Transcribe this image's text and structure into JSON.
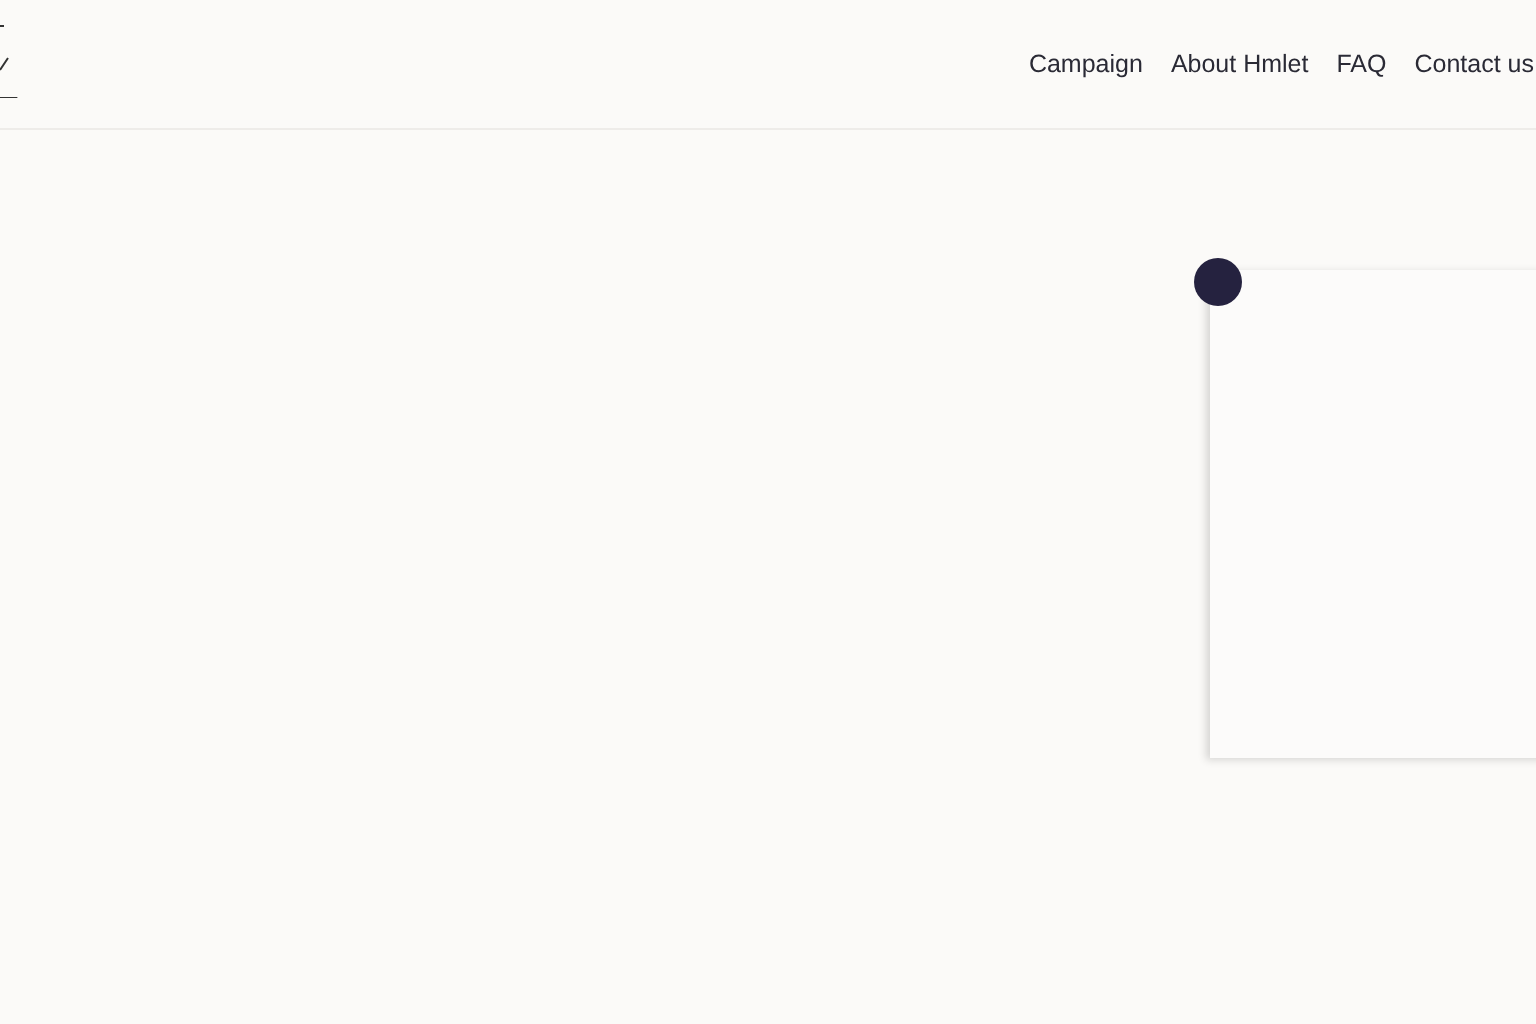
{
  "nav": {
    "links": [
      {
        "label": "Campaign"
      },
      {
        "label": "About Hmlet"
      },
      {
        "label": "FAQ"
      },
      {
        "label": "Contact us"
      }
    ]
  }
}
